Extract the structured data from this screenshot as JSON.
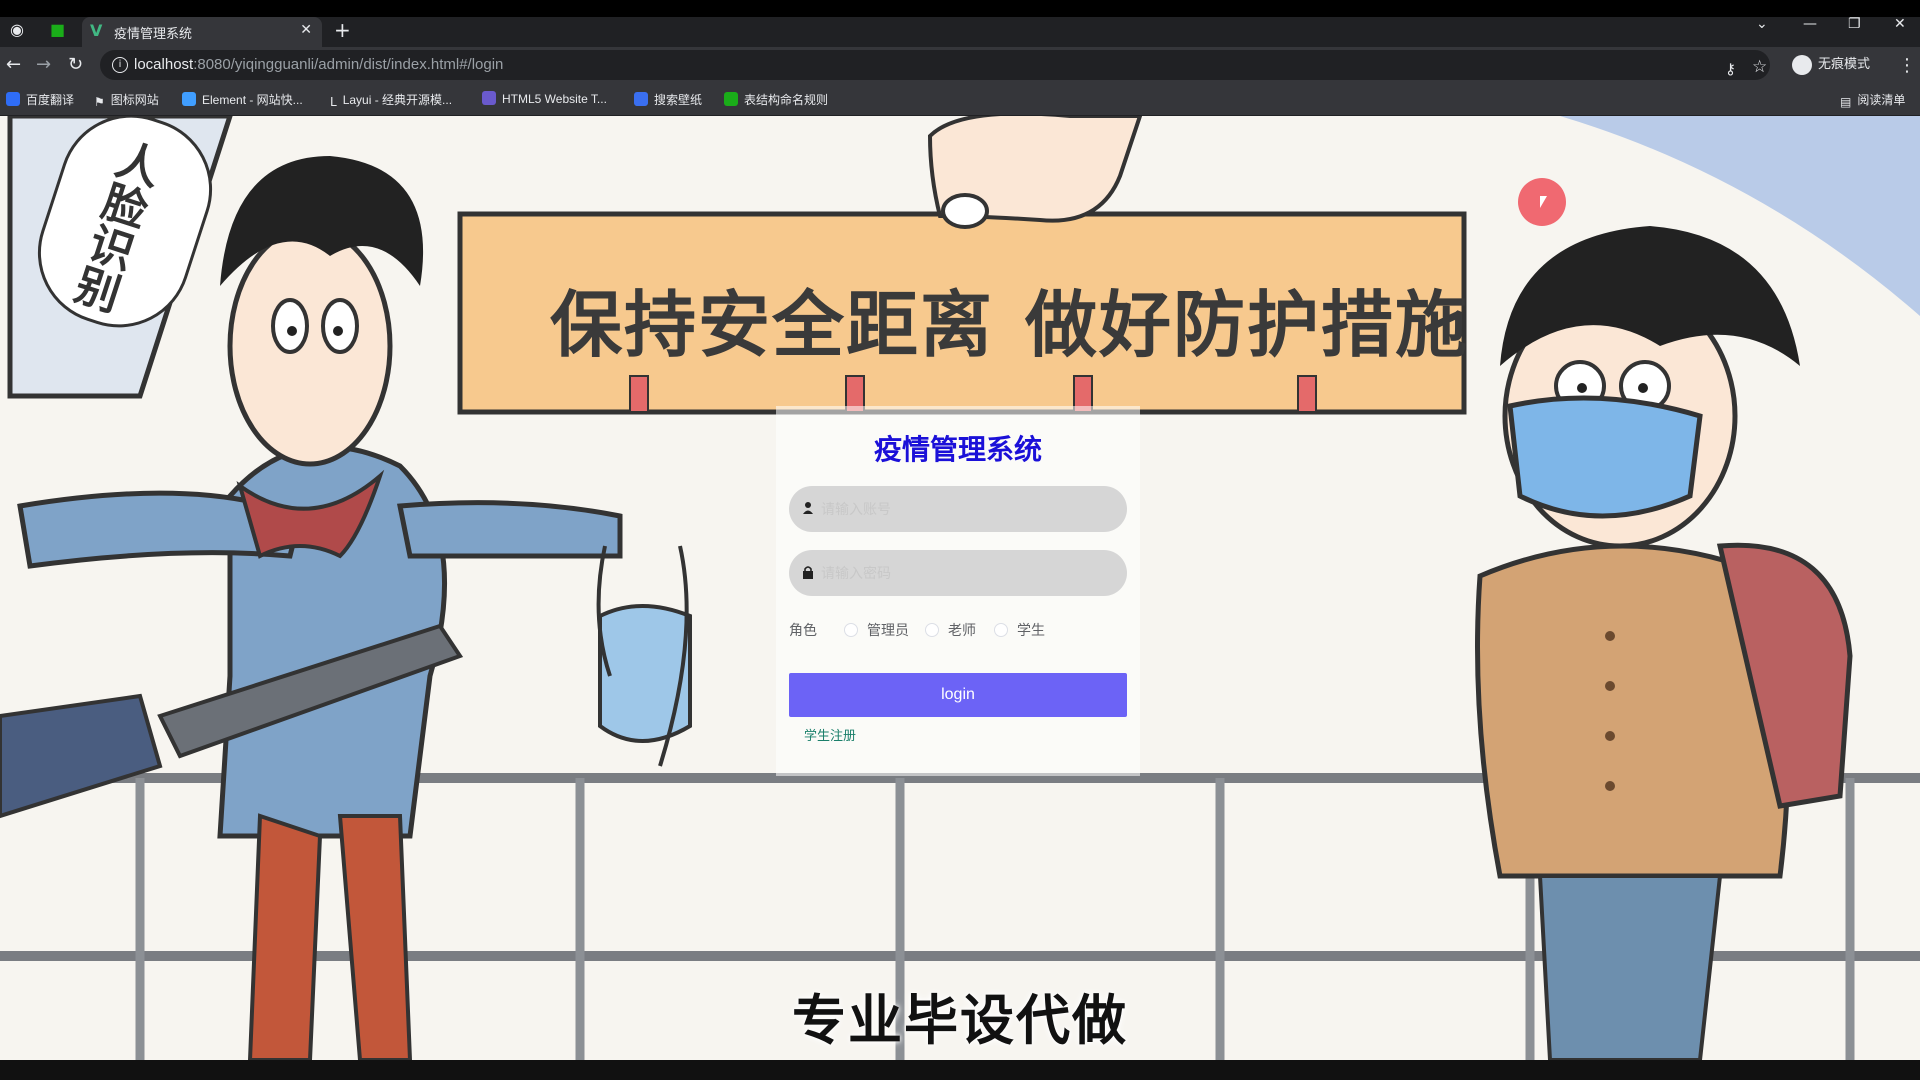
{
  "browser": {
    "tab_title": "疫情管理系统",
    "url_host": "localhost",
    "url_rest": ":8080/yiqingguanli/admin/dist/index.html#/login",
    "profile_label": "无痕模式",
    "reading_list": "阅读清单"
  },
  "bookmarks": [
    {
      "label": "百度翻译",
      "color": "#2f6df6"
    },
    {
      "label": "图标网站",
      "color": "#e8eaed"
    },
    {
      "label": "Element - 网站快...",
      "color": "#409eff"
    },
    {
      "label": "Layui - 经典开源模...",
      "color": "#e8eaed"
    },
    {
      "label": "HTML5 Website T...",
      "color": "#6a5acd"
    },
    {
      "label": "搜索壁纸",
      "color": "#3a6ff0"
    },
    {
      "label": "表结构命名规则",
      "color": "#1aad19"
    }
  ],
  "banner": {
    "left_text": "保持安全距离",
    "right_text": "做好防护措施",
    "sign_text": "人脸识别"
  },
  "login": {
    "title": "疫情管理系统",
    "username_placeholder": "请输入账号",
    "password_placeholder": "请输入密码",
    "role_label": "角色",
    "roles": [
      "管理员",
      "老师",
      "学生"
    ],
    "login_button": "login",
    "register_link": "学生注册"
  },
  "caption": "专业毕设代做",
  "colors": {
    "title": "#1b10d8",
    "login_button": "#6c63f6",
    "register_link": "#1a7f6a"
  }
}
